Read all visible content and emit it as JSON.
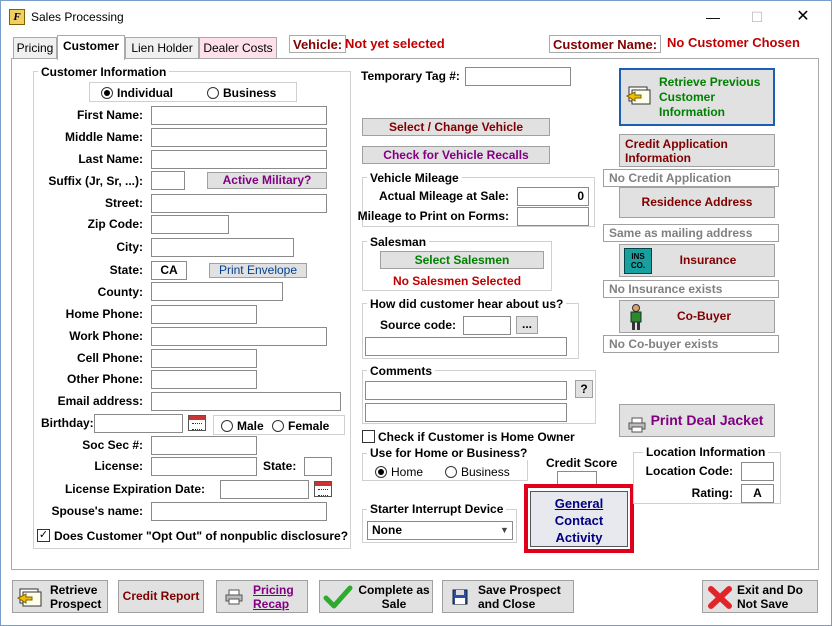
{
  "window": {
    "title": "Sales Processing",
    "app_icon_letter": "F"
  },
  "tabs": [
    "Pricing",
    "Customer",
    "Lien Holder",
    "Dealer Costs"
  ],
  "header": {
    "vehicle_label": "Vehicle:",
    "vehicle_value": "Not yet selected",
    "customer_label": "Customer Name:",
    "customer_value": "No Customer Chosen"
  },
  "customer_info": {
    "group_title": "Customer Information",
    "type_individual": "Individual",
    "type_business": "Business",
    "first_name": "First Name:",
    "middle_name": "Middle Name:",
    "last_name": "Last Name:",
    "suffix": "Suffix (Jr, Sr, ...):",
    "active_military": "Active Military?",
    "street": "Street:",
    "zip": "Zip Code:",
    "city": "City:",
    "state": "State:",
    "state_value": "CA",
    "print_envelope": "Print Envelope",
    "county": "County:",
    "home_phone": "Home Phone:",
    "work_phone": "Work Phone:",
    "cell_phone": "Cell Phone:",
    "other_phone": "Other Phone:",
    "email": "Email address:",
    "birthday": "Birthday:",
    "male": "Male",
    "female": "Female",
    "ssn": "Soc Sec #:",
    "license": "License:",
    "license_state": "State:",
    "license_exp": "License Expiration Date:",
    "spouse": "Spouse's name:",
    "opt_out": "Does Customer \"Opt Out\" of nonpublic disclosure?"
  },
  "middle": {
    "temp_tag": "Temporary Tag #:",
    "select_vehicle": "Select / Change Vehicle",
    "check_recalls": "Check for Vehicle Recalls",
    "mileage_title": "Vehicle Mileage",
    "actual_mileage": "Actual Mileage at Sale:",
    "actual_mileage_value": "0",
    "mileage_print": "Mileage to Print on Forms:",
    "salesman_title": "Salesman",
    "select_salesmen": "Select Salesmen",
    "no_salesmen": "No Salesmen Selected",
    "hear_title": "How did customer hear about us?",
    "source_code": "Source code:",
    "ellipsis": "...",
    "comments_title": "Comments",
    "question": "?",
    "home_owner": "Check if Customer is Home Owner",
    "use_title": "Use for Home or Business?",
    "use_home": "Home",
    "use_business": "Business",
    "credit_score": "Credit Score",
    "starter_title": "Starter Interrupt Device",
    "starter_value": "None",
    "gca_line1": "General",
    "gca_line2": "Contact",
    "gca_line3": "Activity"
  },
  "right": {
    "retrieve_prev_1": "Retrieve Previous",
    "retrieve_prev_2": "Customer",
    "retrieve_prev_3": "Information",
    "credit_app_1": "Credit Application",
    "credit_app_2": "Information",
    "no_credit_app": "No Credit Application",
    "residence": "Residence Address",
    "same_mailing": "Same as mailing address",
    "insurance": "Insurance",
    "ins_icon_text": "INS CO.",
    "no_insurance": "No Insurance exists",
    "cobuyer": "Co-Buyer",
    "no_cobuyer": "No Co-buyer exists",
    "print_jacket": "Print Deal Jacket",
    "location_title": "Location Information",
    "location_code": "Location Code:",
    "rating": "Rating:",
    "rating_value": "A"
  },
  "bottom": {
    "retrieve_1": "Retrieve",
    "retrieve_2": "Prospect",
    "credit_report": "Credit Report",
    "pricing_1": "Pricing",
    "pricing_2": "Recap",
    "complete_1": "Complete as",
    "complete_2": "Sale",
    "save_1": "Save Prospect",
    "save_2": "and Close",
    "exit_1": "Exit and Do",
    "exit_2": "Not Save"
  },
  "colors": {
    "highlight": "#e0001b",
    "purple": "#800080",
    "green": "#008000",
    "red": "#c00000",
    "navy": "#000080"
  }
}
